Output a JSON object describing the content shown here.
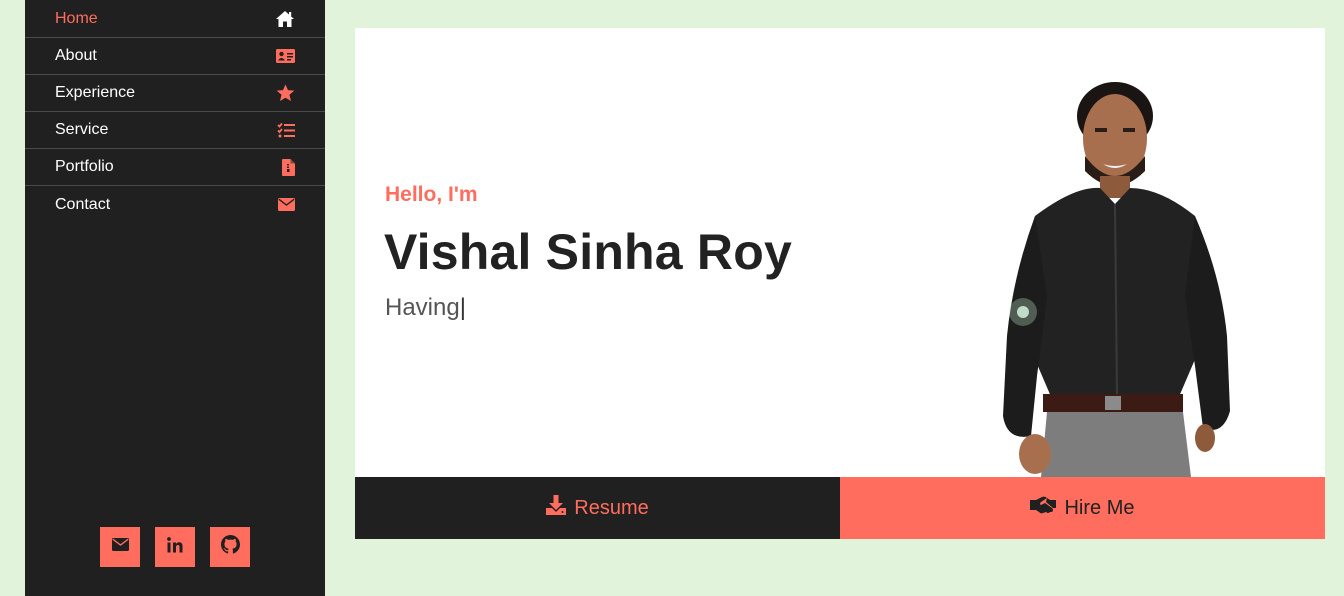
{
  "sidebar": {
    "items": [
      {
        "label": "Home",
        "icon": "home-icon",
        "active": true
      },
      {
        "label": "About",
        "icon": "id-card-icon"
      },
      {
        "label": "Experience",
        "icon": "star-icon"
      },
      {
        "label": "Service",
        "icon": "task-list-icon"
      },
      {
        "label": "Portfolio",
        "icon": "file-icon"
      },
      {
        "label": "Contact",
        "icon": "envelope-icon"
      }
    ],
    "social": [
      "envelope-icon",
      "linkedin-icon",
      "github-icon"
    ]
  },
  "hero": {
    "greeting": "Hello, I'm",
    "name": "Vishal Sinha Roy",
    "typed": "Having",
    "cursor": "|"
  },
  "actions": {
    "resume": "Resume",
    "hire": "Hire Me"
  },
  "colors": {
    "accent": "#ff6d5e",
    "sidebar_bg": "#202020",
    "page_bg": "#e2f3dc"
  }
}
